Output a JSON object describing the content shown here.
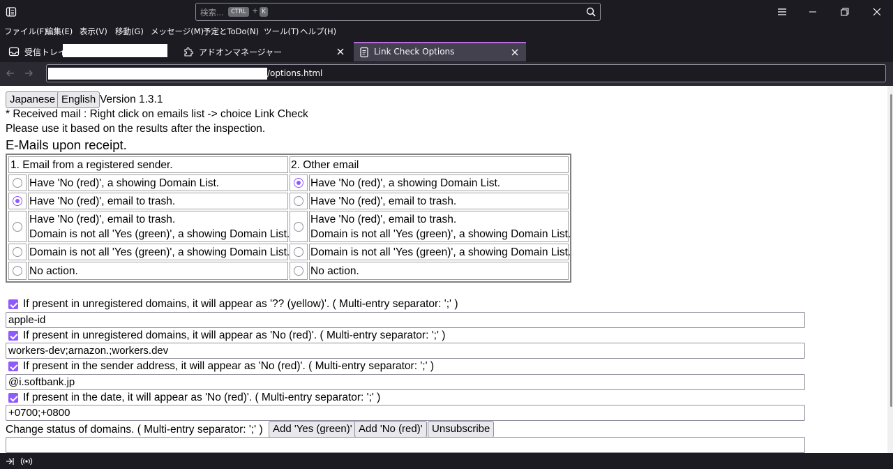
{
  "search": {
    "placeholder": "検索...",
    "key1": "CTRL",
    "plus": "+",
    "key2": "K"
  },
  "menu": [
    "ファイル(F)",
    "編集(E)",
    "表示(V)",
    "移動(G)",
    "メッセージ(M)",
    "予定とToDo(N)",
    "ツール(T)",
    "ヘルプ(H)"
  ],
  "tabs": [
    {
      "label": "受信トレイ -",
      "icon": "inbox-icon"
    },
    {
      "label": "アドオンマネージャー",
      "icon": "puzzle-icon"
    },
    {
      "label": "Link Check Options",
      "icon": "document-icon",
      "active": true
    }
  ],
  "address": {
    "url_suffix": "/options.html"
  },
  "page": {
    "lang_ja": "Japanese",
    "lang_en": "English",
    "version": "Version 1.3.1",
    "note1": "* Received mail : Right click on emails list -> choice Link Check",
    "note2": "Please use it based on the results after the inspection.",
    "heading": "E-Mails upon receipt.",
    "col1_header": "1. Email from a registered sender.",
    "col2_header": "2. Other email",
    "options": [
      "Have 'No (red)', a showing Domain List.",
      "Have 'No (red)', email to trash.",
      "Have 'No (red)', email to trash.",
      "Domain is not all 'Yes (green)', a showing Domain List.",
      "Domain is not all 'Yes (green)', a showing Domain List.",
      "No action."
    ],
    "col1_selected": 1,
    "col2_selected": 0,
    "filters": [
      {
        "label": "If present in unregistered domains, it will appear as '?? (yellow)'. ( Multi-entry separator: ';' )",
        "value": "apple-id",
        "checked": true
      },
      {
        "label": "If present in unregistered domains, it will appear as 'No (red)'. ( Multi-entry separator: ';' )",
        "value": "workers-dev;arnazon.;workers.dev",
        "checked": true
      },
      {
        "label": "If present in the sender address, it will appear as 'No (red)'. ( Multi-entry separator: ';' )",
        "value": "@i.softbank.jp",
        "checked": true
      },
      {
        "label": "If present in the date, it will appear as 'No (red)'. ( Multi-entry separator: ';' )",
        "value": "+0700;+0800",
        "checked": true
      }
    ],
    "change_status_label": "Change status of domains. ( Multi-entry separator: ';' )",
    "btn_add_yes": "Add 'Yes (green)'",
    "btn_add_no": "Add 'No (red)'",
    "btn_unsubscribe": "Unsubscribe",
    "change_status_value": ""
  },
  "colors": {
    "accent": "#9059ff",
    "tab_accent": "#b86bde",
    "chrome_bg": "#1c1b22",
    "toolbar_bg": "#2b2a33"
  }
}
